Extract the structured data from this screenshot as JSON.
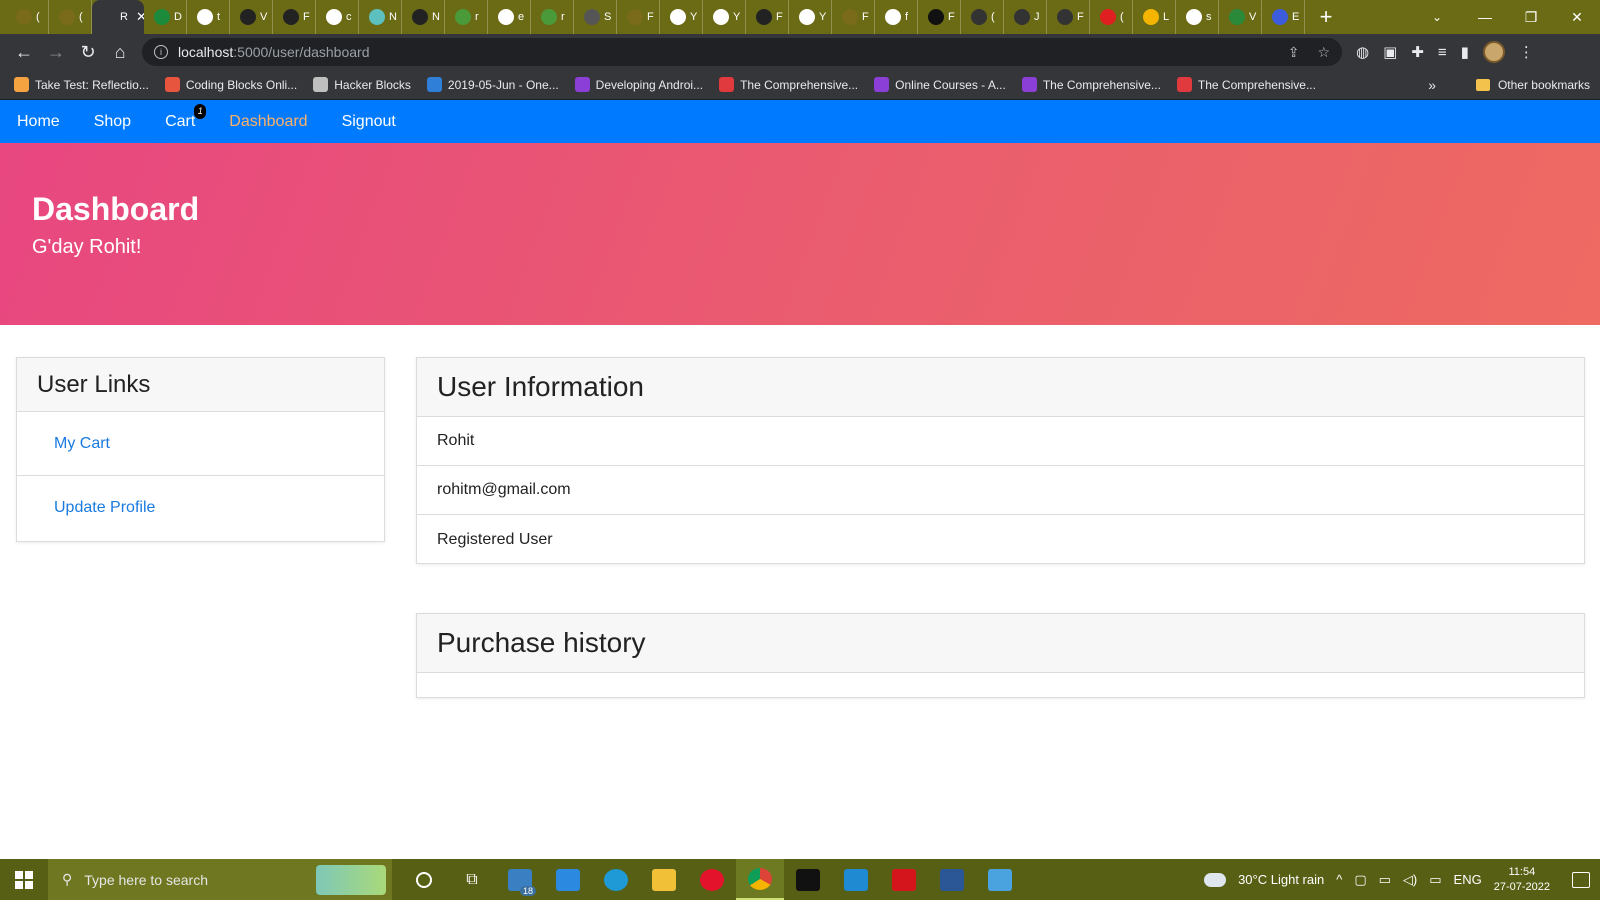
{
  "browser": {
    "tabs": [
      {
        "label": "(",
        "color": "#7a6b1a"
      },
      {
        "label": "(",
        "color": "#7a6b1a"
      },
      {
        "label": "R",
        "color": "#35363a",
        "active": true
      },
      {
        "label": "D",
        "color": "#1b8a3a"
      },
      {
        "label": "t",
        "color": "#ffffff"
      },
      {
        "label": "V",
        "color": "#222222"
      },
      {
        "label": "F",
        "color": "#222222"
      },
      {
        "label": "c",
        "color": "#ffffff"
      },
      {
        "label": "N",
        "color": "#5bc0be"
      },
      {
        "label": "N",
        "color": "#222222"
      },
      {
        "label": "r",
        "color": "#4a9a3a"
      },
      {
        "label": "e",
        "color": "#ffffff"
      },
      {
        "label": "r",
        "color": "#4a9a3a"
      },
      {
        "label": "S",
        "color": "#555555"
      },
      {
        "label": "F",
        "color": "#7a6b1a"
      },
      {
        "label": "Y",
        "color": "#ffffff"
      },
      {
        "label": "Y",
        "color": "#ffffff"
      },
      {
        "label": "F",
        "color": "#222222"
      },
      {
        "label": "Y",
        "color": "#ffffff"
      },
      {
        "label": "F",
        "color": "#7a6b1a"
      },
      {
        "label": "f",
        "color": "#ffffff"
      },
      {
        "label": "F",
        "color": "#111111"
      },
      {
        "label": "(",
        "color": "#333333"
      },
      {
        "label": "J",
        "color": "#333333"
      },
      {
        "label": "F",
        "color": "#333333"
      },
      {
        "label": "(",
        "color": "#e02020"
      },
      {
        "label": "L",
        "color": "#f4b400"
      },
      {
        "label": "s",
        "color": "#ffffff"
      },
      {
        "label": "V",
        "color": "#2a8a3a"
      },
      {
        "label": "E",
        "color": "#3b5bdb"
      }
    ],
    "active_tab_close": "✕",
    "new_tab": "+",
    "address": {
      "host": "localhost",
      "path": ":5000/user/dashboard"
    },
    "bookmarks": [
      {
        "label": "Take Test: Reflectio...",
        "color": "#f4a340"
      },
      {
        "label": "Coding Blocks Onli...",
        "color": "#e8553e"
      },
      {
        "label": "Hacker Blocks",
        "color": "#bfbfbf"
      },
      {
        "label": "2019-05-Jun - One...",
        "color": "#2f7fd8"
      },
      {
        "label": "Developing Androi...",
        "color": "#8b3fd6"
      },
      {
        "label": "The Comprehensive...",
        "color": "#e0393e"
      },
      {
        "label": "Online Courses - A...",
        "color": "#8b3fd6"
      },
      {
        "label": "The Comprehensive...",
        "color": "#8b3fd6"
      },
      {
        "label": "The Comprehensive...",
        "color": "#e0393e"
      }
    ],
    "bookmarks_more": "»",
    "other_bookmarks": "Other bookmarks"
  },
  "navbar": {
    "home": "Home",
    "shop": "Shop",
    "cart": "Cart",
    "cart_count": "1",
    "dashboard": "Dashboard",
    "signout": "Signout"
  },
  "hero": {
    "title": "Dashboard",
    "subtitle": "G'day Rohit!"
  },
  "user_links": {
    "title": "User Links",
    "items": [
      "My Cart",
      "Update Profile"
    ]
  },
  "user_info": {
    "title": "User Information",
    "name": "Rohit",
    "email": "rohitm@gmail.com",
    "role": "Registered User"
  },
  "purchase_history": {
    "title": "Purchase history"
  },
  "taskbar": {
    "search_placeholder": "Type here to search",
    "mail_badge": "18",
    "weather": "30°C  Light rain",
    "lang": "ENG",
    "time": "11:54",
    "date": "27-07-2022"
  },
  "colors": {
    "nav_bg": "#007bff",
    "nav_active": "#ffb067",
    "hero_start": "#e84780",
    "hero_end": "#ee6a62",
    "link": "#1a7ae0"
  }
}
